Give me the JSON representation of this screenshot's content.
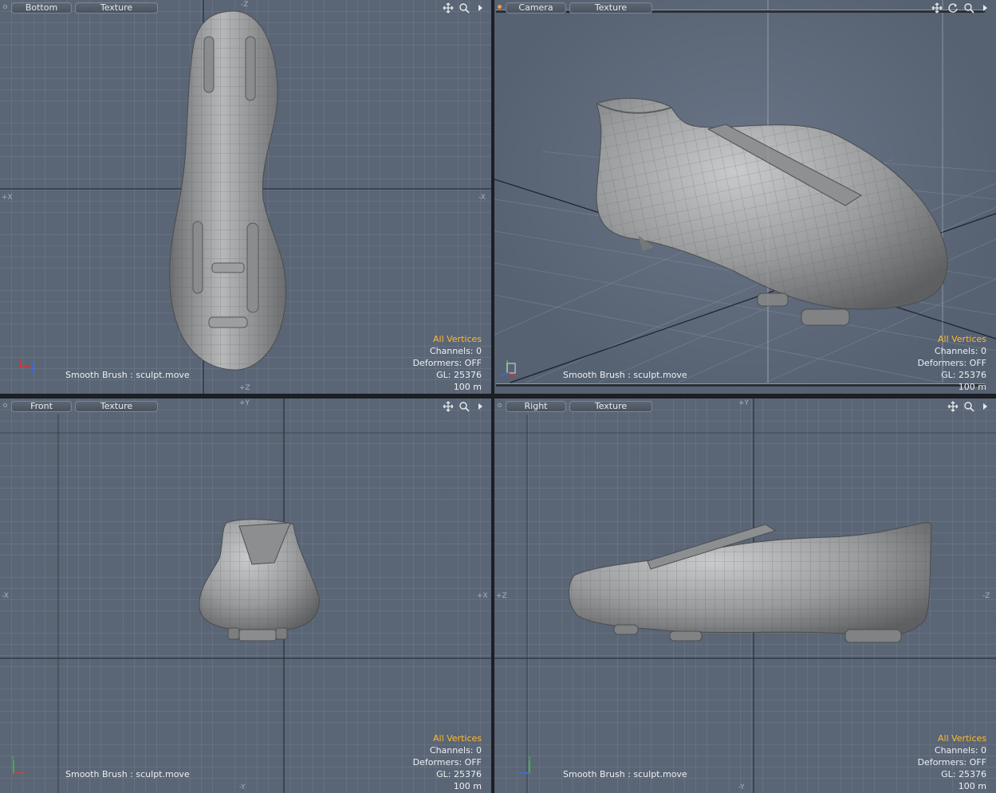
{
  "app": {
    "brush_status": "Smooth Brush : sculpt.move",
    "selection_mode": "All Vertices",
    "channels": "Channels: 0",
    "deformers": "Deformers: OFF",
    "gl_count": "GL: 25376",
    "scale": "100 m",
    "accent_color": "#ffb92e"
  },
  "viewports": {
    "bottom": {
      "view_label": "Bottom",
      "shading_label": "Texture",
      "axes": {
        "top": "-Z",
        "bottom": "+Z",
        "left": "+X",
        "right": "-X"
      },
      "tools": [
        "move-view-icon",
        "zoom-icon",
        "more-arrow-icon"
      ]
    },
    "camera": {
      "view_label": "Camera",
      "shading_label": "Texture",
      "tools": [
        "move-view-icon",
        "rotate-view-icon",
        "zoom-icon",
        "more-arrow-icon"
      ]
    },
    "front": {
      "view_label": "Front",
      "shading_label": "Texture",
      "axes": {
        "top": "+Y",
        "bottom": "-Y",
        "left": "-X",
        "right": "+X"
      },
      "tools": [
        "move-view-icon",
        "zoom-icon",
        "more-arrow-icon"
      ]
    },
    "right": {
      "view_label": "Right",
      "shading_label": "Texture",
      "axes": {
        "top": "+Y",
        "bottom": "-Y",
        "left": "+Z",
        "right": "-Z"
      },
      "tools": [
        "move-view-icon",
        "zoom-icon",
        "more-arrow-icon"
      ]
    }
  }
}
